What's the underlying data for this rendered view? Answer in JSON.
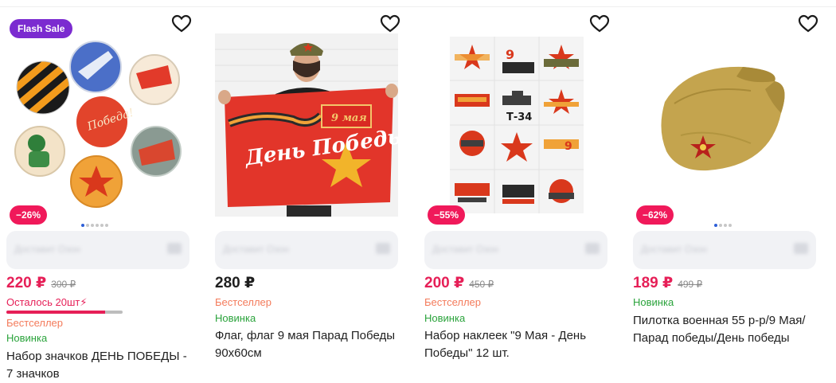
{
  "products": [
    {
      "flash_badge": "Flash Sale",
      "discount": "−26%",
      "price": "220 ₽",
      "old_price": "300 ₽",
      "remaining_text": "Осталось 20шт⚡",
      "remaining_progress": 0.85,
      "bestseller": "Бестселлер",
      "new_label": "Новинка",
      "title": "Набор значков ДЕНЬ ПОБЕДЫ - 7 значков",
      "delivery_text": "Доставит Озон",
      "image_dots": 6,
      "active_dot": 0
    },
    {
      "price": "280 ₽",
      "bestseller": "Бестселлер",
      "new_label": "Новинка",
      "title": "Флаг, флаг 9 мая Парад Победы 90x60см",
      "delivery_text": "Доставит Озон",
      "flag_text": "День Победы",
      "flag_date": "9 мая"
    },
    {
      "discount": "−55%",
      "price": "200 ₽",
      "old_price": "450 ₽",
      "bestseller": "Бестселлер",
      "new_label": "Новинка",
      "title": "Набор наклеек \"9 Мая - День Победы\" 12 шт.",
      "delivery_text": "Доставит Озон",
      "sticker_tank_text": "Т-34"
    },
    {
      "discount": "−62%",
      "price": "189 ₽",
      "old_price": "499 ₽",
      "new_label": "Новинка",
      "title": "Пилотка военная 55 р-р/9 Мая/Парад победы/День победы",
      "delivery_text": "Доставит Озон",
      "image_dots": 4,
      "active_dot": 0
    }
  ],
  "colors": {
    "accent_red": "#e61f57",
    "discount_badge": "#f0195a",
    "flash_badge": "#7b2bd0",
    "bestseller": "#f47b5b",
    "new": "#2aa33b"
  },
  "icons": {
    "favorite": "heart-outline-icon",
    "lightning": "lightning-icon"
  }
}
